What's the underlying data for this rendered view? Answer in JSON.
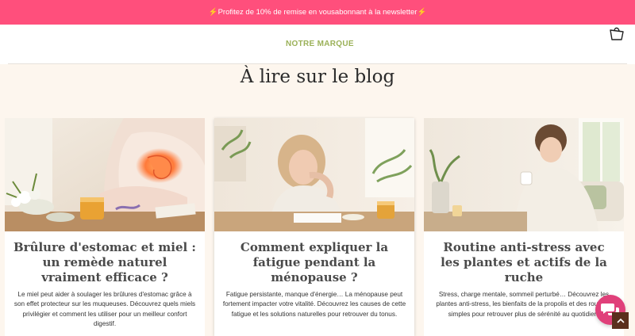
{
  "announcement": {
    "bolt_left": "⚡",
    "text_before": " Profitez de 10% de remise en vous ",
    "link_text": "abonnant à la newsletter",
    "bolt_right": " ⚡"
  },
  "header": {
    "nav_item": "NOTRE MARQUE",
    "cart_icon": "shopping-bag-icon"
  },
  "section": {
    "title": "À lire sur le blog"
  },
  "cards": [
    {
      "title": "Brûlure d'estomac et miel : un remède naturel vraiment efficace ?",
      "excerpt": "Le miel peut aider à soulager les brûlures d'estomac grâce à son effet protecteur sur les muqueuses. Découvrez quels miels privilégier et comment les utiliser pour un meilleur confort digestif."
    },
    {
      "title": "Comment expliquer la fatigue pendant la ménopause ?",
      "excerpt": "Fatigue persistante, manque d'énergie… La ménopause peut fortement impacter votre vitalité. Découvrez les causes de cette fatigue et les solutions naturelles pour retrouver du tonus."
    },
    {
      "title": "Routine anti-stress avec les plantes et actifs de la ruche",
      "excerpt": "Stress, charge mentale, sommeil perturbé… Découvrez les plantes anti-stress, les bienfaits de la propolis et des routines simples pour retrouver plus de sérénité au quotidien."
    }
  ],
  "colors": {
    "announcement_bg": "#ff4f7c",
    "nav_accent": "#9bb158",
    "chat_button": "#e0407a",
    "scroll_top_button": "#5a2f1d",
    "page_bg": "#fdf6ee"
  },
  "widgets": {
    "chat_icon": "chat-bubbles-icon",
    "scroll_icon": "arrow-up-icon"
  }
}
